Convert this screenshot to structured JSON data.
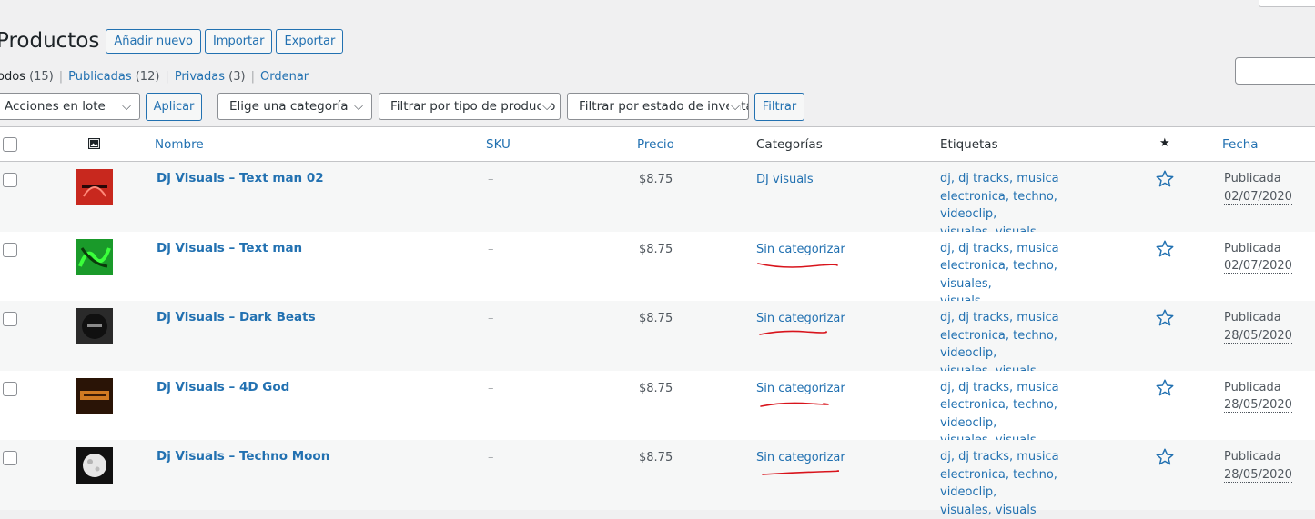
{
  "page": {
    "title": "Productos",
    "add_new": "Añadir nuevo",
    "import": "Importar",
    "export": "Exportar"
  },
  "views": [
    {
      "label": "odos",
      "count": "(15)",
      "current": true
    },
    {
      "label": "Publicadas",
      "count": "(12)"
    },
    {
      "label": "Privadas",
      "count": "(3)"
    },
    {
      "label": "Ordenar",
      "count": ""
    }
  ],
  "separator": "|",
  "filters": {
    "bulk": "Acciones en lote",
    "apply": "Aplicar",
    "category": "Elige una categoría",
    "product_type": "Filtrar por tipo de producto",
    "stock": "Filtrar por estado de inventario",
    "filter": "Filtrar"
  },
  "columns": {
    "name": "Nombre",
    "sku": "SKU",
    "price": "Precio",
    "categories": "Categorías",
    "tags": "Etiquetas",
    "featured": "★",
    "date": "Fecha"
  },
  "rows": [
    {
      "name": "Dj Visuals – Text man 02",
      "sku": "–",
      "price": "$8.75",
      "category": "DJ visuals",
      "tags_l1": "dj, dj tracks, musica",
      "tags_l2": "electronica, techno, videoclip,",
      "tags_l3": "visuales, visuals",
      "status": "Publicada",
      "date": "02/07/2020",
      "thumb_color": "#c8281e",
      "thumb_icon": "red-text-thumbnail"
    },
    {
      "name": "Dj Visuals – Text man",
      "sku": "–",
      "price": "$8.75",
      "category": "Sin categorizar",
      "tags_l1": "dj, dj tracks, musica",
      "tags_l2": "electronica, techno, visuales,",
      "tags_l3": "visuals",
      "status": "Publicada",
      "date": "02/07/2020",
      "thumb_color": "#1a9a2a",
      "thumb_icon": "green-text-thumbnail"
    },
    {
      "name": "Dj Visuals – Dark Beats",
      "sku": "–",
      "price": "$8.75",
      "category": "Sin categorizar",
      "tags_l1": "dj, dj tracks, musica",
      "tags_l2": "electronica, techno, videoclip,",
      "tags_l3": "visuales, visuals",
      "status": "Publicada",
      "date": "28/05/2020",
      "thumb_color": "#2a2a2a",
      "thumb_icon": "dark-thumbnail"
    },
    {
      "name": "Dj Visuals – 4D God",
      "sku": "–",
      "price": "$8.75",
      "category": "Sin categorizar",
      "tags_l1": "dj, dj tracks, musica",
      "tags_l2": "electronica, techno, videoclip,",
      "tags_l3": "visuales, visuals",
      "status": "Publicada",
      "date": "28/05/2020",
      "thumb_color": "#b8621a",
      "thumb_icon": "orange-thumbnail"
    },
    {
      "name": "Dj Visuals – Techno Moon",
      "sku": "–",
      "price": "$8.75",
      "category": "Sin categorizar",
      "tags_l1": "dj, dj tracks, musica",
      "tags_l2": "electronica, techno, videoclip,",
      "tags_l3": "visuales, visuals",
      "status": "Publicada",
      "date": "28/05/2020",
      "thumb_color": "#111111",
      "thumb_icon": "moon-thumbnail"
    }
  ],
  "colors": {
    "accent": "#2271b1",
    "scribble": "#d8141c"
  }
}
